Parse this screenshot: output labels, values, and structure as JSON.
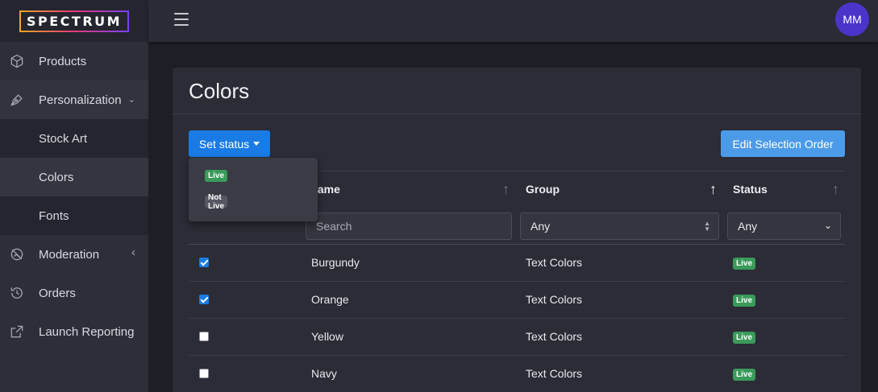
{
  "app": {
    "logo": "SPECTRUM"
  },
  "user": {
    "initials": "MM"
  },
  "sidebar": {
    "items": [
      {
        "label": "Products"
      },
      {
        "label": "Personalization",
        "chevron": "⌄"
      },
      {
        "label": "Stock Art"
      },
      {
        "label": "Colors"
      },
      {
        "label": "Fonts"
      },
      {
        "label": "Moderation",
        "chevron": "‹"
      },
      {
        "label": "Orders"
      },
      {
        "label": "Launch Reporting"
      }
    ]
  },
  "page": {
    "title": "Colors",
    "set_status_label": "Set status",
    "edit_order_label": "Edit Selection Order"
  },
  "dropdown": {
    "items": [
      {
        "label": "Live",
        "color": "#3a9a5a"
      },
      {
        "label": "Not Live",
        "color": "#555862"
      }
    ]
  },
  "table": {
    "columns": [
      {
        "label": "Name",
        "visible_text": "lame",
        "sort": "↑"
      },
      {
        "label": "Group",
        "sort": "↑"
      },
      {
        "label": "Status",
        "sort": "↑"
      }
    ],
    "filters": {
      "search_placeholder": "Search",
      "group_value": "Any",
      "status_value": "Any"
    },
    "rows": [
      {
        "checked": true,
        "name": "Burgundy",
        "group": "Text Colors",
        "status": "Live"
      },
      {
        "checked": true,
        "name": "Orange",
        "group": "Text Colors",
        "status": "Live"
      },
      {
        "checked": false,
        "name": "Yellow",
        "group": "Text Colors",
        "status": "Live"
      },
      {
        "checked": false,
        "name": "Navy",
        "group": "Text Colors",
        "status": "Live"
      }
    ]
  },
  "colors": {
    "primary": "#1a7be5",
    "secondary_button": "#4c9be8",
    "live_badge": "#3a9a5a",
    "avatar": "#4a34c9"
  }
}
